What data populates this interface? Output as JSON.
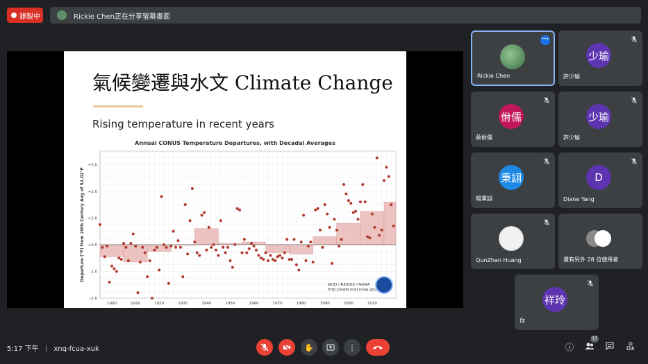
{
  "recording": {
    "label": "錄製中"
  },
  "share_banner": {
    "text": "Rickie Chen正在分享螢幕畫面"
  },
  "slide": {
    "title": "氣候變遷與水文 Climate Change",
    "subtitle": "Rising temperature in recent years",
    "chart_title": "Annual CONUS Temperature Departures, with Decadal Averages",
    "credit_line1": "NCEI / NESDIS / NOAA",
    "credit_line2": "http://www.ncei.noaa.gov/"
  },
  "chart_data": {
    "type": "scatter",
    "title": "Annual CONUS Temperature Departures, with Decadal Averages",
    "ylabel": "Departure (°F) from 20th Century Avg of 52.02°F",
    "xlabel": "",
    "xlim": [
      1895,
      2020
    ],
    "ylim": [
      -2.0,
      3.5
    ],
    "xticks": [
      "1900",
      "1910",
      "1920",
      "1930",
      "1940",
      "1950",
      "1960",
      "1970",
      "1980",
      "1990",
      "2000",
      "2010"
    ],
    "yticks": [
      "+3.0",
      "+2.0",
      "+1.0",
      "+0.0",
      "-1.0",
      "-2.0"
    ],
    "points": [
      [
        1895,
        0.75
      ],
      [
        1896,
        -0.1
      ],
      [
        1897,
        -0.45
      ],
      [
        1898,
        -0.05
      ],
      [
        1899,
        -1.4
      ],
      [
        1900,
        -0.8
      ],
      [
        1901,
        -0.9
      ],
      [
        1902,
        -1.0
      ],
      [
        1903,
        -0.5
      ],
      [
        1904,
        -0.55
      ],
      [
        1905,
        0.05
      ],
      [
        1906,
        -0.1
      ],
      [
        1907,
        -0.6
      ],
      [
        1908,
        0.05
      ],
      [
        1909,
        0.4
      ],
      [
        1910,
        -0.05
      ],
      [
        1911,
        -1.8
      ],
      [
        1912,
        -0.65
      ],
      [
        1913,
        -0.1
      ],
      [
        1914,
        -0.3
      ],
      [
        1915,
        -1.2
      ],
      [
        1916,
        -0.6
      ],
      [
        1917,
        -2.0
      ],
      [
        1918,
        -0.2
      ],
      [
        1919,
        -0.1
      ],
      [
        1920,
        -0.95
      ],
      [
        1921,
        1.8
      ],
      [
        1922,
        0.0
      ],
      [
        1923,
        -0.1
      ],
      [
        1924,
        -1.45
      ],
      [
        1925,
        -0.05
      ],
      [
        1926,
        0.5
      ],
      [
        1927,
        -0.1
      ],
      [
        1928,
        0.15
      ],
      [
        1929,
        -0.1
      ],
      [
        1930,
        -1.2
      ],
      [
        1931,
        1.5
      ],
      [
        1932,
        -0.35
      ],
      [
        1933,
        0.9
      ],
      [
        1934,
        2.1
      ],
      [
        1935,
        0.1
      ],
      [
        1936,
        -0.3
      ],
      [
        1937,
        -0.4
      ],
      [
        1938,
        1.1
      ],
      [
        1939,
        1.2
      ],
      [
        1940,
        -0.2
      ],
      [
        1941,
        0.65
      ],
      [
        1942,
        -0.1
      ],
      [
        1943,
        0.0
      ],
      [
        1944,
        -0.2
      ],
      [
        1945,
        -0.4
      ],
      [
        1946,
        0.9
      ],
      [
        1947,
        -0.1
      ],
      [
        1948,
        -0.3
      ],
      [
        1949,
        -0.1
      ],
      [
        1950,
        -0.6
      ],
      [
        1951,
        -0.85
      ],
      [
        1952,
        0.0
      ],
      [
        1953,
        1.35
      ],
      [
        1954,
        1.3
      ],
      [
        1955,
        -0.3
      ],
      [
        1956,
        0.2
      ],
      [
        1957,
        -0.3
      ],
      [
        1958,
        -0.15
      ],
      [
        1959,
        0.05
      ],
      [
        1960,
        -0.05
      ],
      [
        1961,
        -0.2
      ],
      [
        1962,
        -0.4
      ],
      [
        1963,
        -0.5
      ],
      [
        1964,
        -0.55
      ],
      [
        1965,
        -0.3
      ],
      [
        1966,
        -0.6
      ],
      [
        1967,
        -0.4
      ],
      [
        1968,
        -0.55
      ],
      [
        1969,
        -0.6
      ],
      [
        1970,
        -0.45
      ],
      [
        1971,
        -0.4
      ],
      [
        1972,
        -0.5
      ],
      [
        1973,
        -0.3
      ],
      [
        1974,
        0.2
      ],
      [
        1975,
        -0.55
      ],
      [
        1976,
        -0.55
      ],
      [
        1977,
        0.2
      ],
      [
        1978,
        -0.75
      ],
      [
        1979,
        -0.95
      ],
      [
        1980,
        0.1
      ],
      [
        1981,
        1.1
      ],
      [
        1982,
        -0.6
      ],
      [
        1983,
        -0.05
      ],
      [
        1984,
        0.1
      ],
      [
        1985,
        -0.65
      ],
      [
        1986,
        1.3
      ],
      [
        1987,
        1.35
      ],
      [
        1988,
        0.55
      ],
      [
        1989,
        -0.1
      ],
      [
        1990,
        1.5
      ],
      [
        1991,
        1.15
      ],
      [
        1992,
        0.65
      ],
      [
        1993,
        -0.7
      ],
      [
        1994,
        0.95
      ],
      [
        1995,
        0.55
      ],
      [
        1996,
        -0.05
      ],
      [
        1997,
        0.2
      ],
      [
        1998,
        2.25
      ],
      [
        1999,
        1.9
      ],
      [
        2000,
        1.65
      ],
      [
        2001,
        1.55
      ],
      [
        2002,
        1.2
      ],
      [
        2003,
        1.25
      ],
      [
        2004,
        0.95
      ],
      [
        2005,
        1.6
      ],
      [
        2006,
        2.25
      ],
      [
        2007,
        1.6
      ],
      [
        2008,
        0.3
      ],
      [
        2009,
        0.25
      ],
      [
        2010,
        1.15
      ],
      [
        2011,
        0.65
      ],
      [
        2012,
        3.25
      ],
      [
        2013,
        0.35
      ],
      [
        2014,
        0.55
      ],
      [
        2015,
        2.4
      ],
      [
        2016,
        2.9
      ],
      [
        2017,
        2.55
      ],
      [
        2018,
        1.5
      ],
      [
        2019,
        0.7
      ]
    ],
    "decadal_averages": [
      {
        "start": 1895,
        "end": 1905,
        "value": -0.45
      },
      {
        "start": 1905,
        "end": 1915,
        "value": -0.65
      },
      {
        "start": 1915,
        "end": 1925,
        "value": -0.25
      },
      {
        "start": 1925,
        "end": 1935,
        "value": 0.0
      },
      {
        "start": 1935,
        "end": 1945,
        "value": 0.6
      },
      {
        "start": 1945,
        "end": 1955,
        "value": 0.05
      },
      {
        "start": 1955,
        "end": 1965,
        "value": 0.1
      },
      {
        "start": 1965,
        "end": 1975,
        "value": -0.3
      },
      {
        "start": 1975,
        "end": 1985,
        "value": -0.35
      },
      {
        "start": 1985,
        "end": 1995,
        "value": 0.3
      },
      {
        "start": 1995,
        "end": 2005,
        "value": 0.8
      },
      {
        "start": 2005,
        "end": 2015,
        "value": 1.25
      },
      {
        "start": 2015,
        "end": 2020,
        "value": 1.6
      }
    ],
    "grid": true,
    "point_color": "#b03a2e",
    "bar_color": "#e8b4b1"
  },
  "participants": [
    {
      "name": "Rickie Chen",
      "initials": "",
      "color": "#4e7f55",
      "active": true,
      "muted": false
    },
    {
      "name": "許少瑜",
      "initials": "少瑜",
      "color": "#5e35b1",
      "active": false,
      "muted": true
    },
    {
      "name": "蔡佾儒",
      "initials": "佾儒",
      "color": "#c2185b",
      "active": false,
      "muted": true
    },
    {
      "name": "許少瑜",
      "initials": "少瑜",
      "color": "#5e35b1",
      "active": false,
      "muted": true
    },
    {
      "name": "楊秉翃",
      "initials": "秉翃",
      "color": "#1e88e5",
      "active": false,
      "muted": true
    },
    {
      "name": "Diane Yang",
      "initials": "D",
      "color": "#5e35b1",
      "active": false,
      "muted": true
    },
    {
      "name": "QunZhan Huang",
      "initials": "",
      "color": "#f1f1f1",
      "active": false,
      "muted": true
    },
    {
      "name": "還有另外 28 位使用者",
      "initials": "",
      "color": "#f1f1f1",
      "active": false,
      "muted": false
    },
    {
      "name": "你",
      "initials": "祥玲",
      "color": "#5e35b1",
      "active": false,
      "muted": true
    }
  ],
  "bottom": {
    "time": "5:17 下午",
    "separator": "|",
    "meeting_code": "xnq-fcua-xuk",
    "people_count": "37"
  }
}
